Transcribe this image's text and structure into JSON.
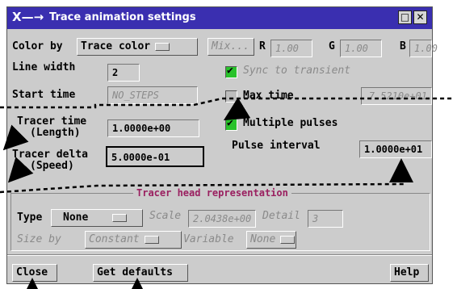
{
  "window": {
    "title": "Trace animation settings",
    "colors": {
      "titlebar": "#3a2fb0",
      "panel": "#cccccc",
      "check_on": "#29c22b",
      "group_title": "#9a2060"
    }
  },
  "titlebar": {
    "app_icon": "x-motif-icon",
    "minimize_icon": "minimize-icon",
    "close_icon": "close-icon"
  },
  "color_row": {
    "label": "Color by",
    "option": "Trace color",
    "mix_button": "Mix...",
    "r_label": "R",
    "r_value": "1.00",
    "g_label": "G",
    "g_value": "1.00",
    "b_label": "B",
    "b_value": "1.00"
  },
  "line_width": {
    "label": "Line width",
    "value": "2"
  },
  "sync": {
    "label": "Sync to transient",
    "checked": true
  },
  "start_time": {
    "label": "Start time",
    "value": "NO_STEPS"
  },
  "max_time": {
    "label": "Max time",
    "value": "7.5210e+01",
    "checked": false
  },
  "tracer_time": {
    "label_line1": "Tracer time",
    "label_line2": "(Length)",
    "value": "1.0000e+00"
  },
  "multiple_pulses": {
    "label": "Multiple pulses",
    "checked": true
  },
  "pulse_interval": {
    "label": "Pulse interval",
    "value": "1.0000e+01"
  },
  "tracer_delta": {
    "label_line1": "Tracer delta",
    "label_line2": "(Speed)",
    "value": "5.0000e-01"
  },
  "head_group": {
    "title": "Tracer head representation",
    "type_label": "Type",
    "type_option": "None",
    "scale_label": "Scale",
    "scale_value": "2.0438e+00",
    "detail_label": "Detail",
    "detail_value": "3",
    "size_by_label": "Size by",
    "size_by_option": "Constant",
    "variable_label": "Variable",
    "variable_option": "None"
  },
  "footer": {
    "close": "Close",
    "get_defaults": "Get defaults",
    "help": "Help"
  }
}
